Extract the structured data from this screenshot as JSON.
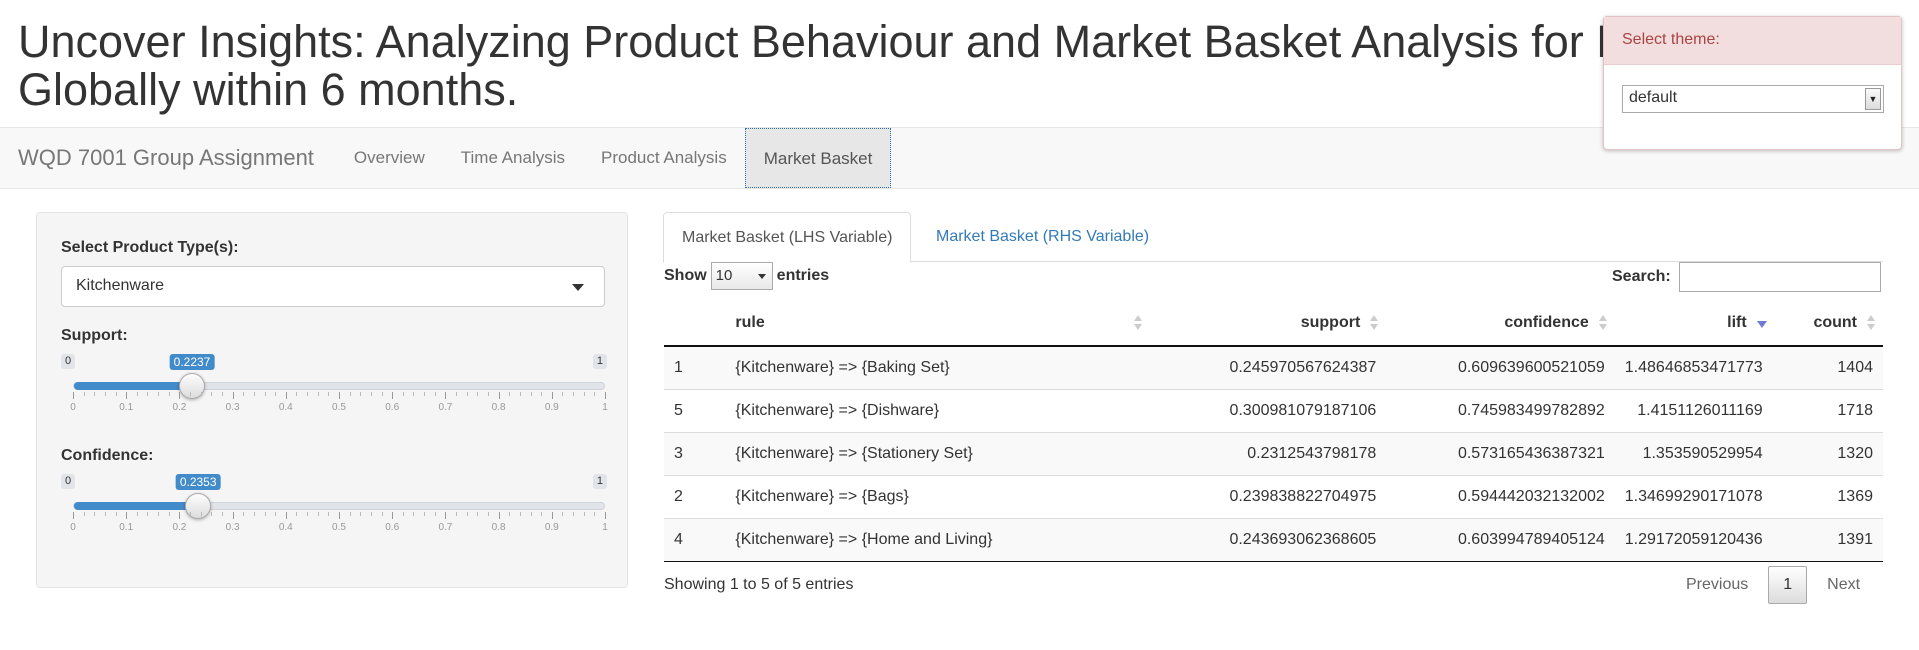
{
  "page": {
    "title_line1": "Uncover Insights: Analyzing Product Behaviour and Market Basket Analysis for Ret",
    "title_line2": "Globally within 6 months."
  },
  "navbar": {
    "brand": "WQD 7001 Group Assignment",
    "tabs": [
      {
        "label": "Overview",
        "active": false
      },
      {
        "label": "Time Analysis",
        "active": false
      },
      {
        "label": "Product Analysis",
        "active": false
      },
      {
        "label": "Market Basket",
        "active": true
      }
    ]
  },
  "theme_selector": {
    "heading": "Select theme:",
    "value": "default"
  },
  "sidebar": {
    "product_type": {
      "label": "Select Product Type(s):",
      "value": "Kitchenware"
    },
    "support": {
      "label": "Support:",
      "min": "0",
      "max": "1",
      "value": "0.2237",
      "fraction": 0.2237
    },
    "confidence": {
      "label": "Confidence:",
      "min": "0",
      "max": "1",
      "value": "0.2353",
      "fraction": 0.2353
    },
    "tick_labels": [
      "0",
      "0.1",
      "0.2",
      "0.3",
      "0.4",
      "0.5",
      "0.6",
      "0.7",
      "0.8",
      "0.9",
      "1"
    ]
  },
  "tabs": [
    {
      "label": "Market Basket (LHS Variable)",
      "active": true
    },
    {
      "label": "Market Basket (RHS Variable)",
      "active": false
    }
  ],
  "table": {
    "show_label": "Show",
    "entries_value": "10",
    "entries_label": "entries",
    "search_label": "Search:",
    "columns": [
      "",
      "rule",
      "support",
      "confidence",
      "lift",
      "count"
    ],
    "sorted_column": "lift",
    "sort_direction": "descending",
    "rows": [
      [
        "1",
        "{Kitchenware} => {Baking Set}",
        "0.245970567624387",
        "0.609639600521059",
        "1.48646853471773",
        "1404"
      ],
      [
        "5",
        "{Kitchenware} => {Dishware}",
        "0.300981079187106",
        "0.745983499782892",
        "1.4151126011169",
        "1718"
      ],
      [
        "3",
        "{Kitchenware} => {Stationery Set}",
        "0.2312543798178",
        "0.573165436387321",
        "1.353590529954",
        "1320"
      ],
      [
        "2",
        "{Kitchenware} => {Bags}",
        "0.239838822704975",
        "0.594442032132002",
        "1.34699290171078",
        "1369"
      ],
      [
        "4",
        "{Kitchenware} => {Home and Living}",
        "0.243693062368605",
        "0.603994789405124",
        "1.29172059120436",
        "1391"
      ]
    ],
    "info": "Showing 1 to 5 of 5 entries",
    "pager": {
      "previous": "Previous",
      "current": "1",
      "next": "Next"
    }
  }
}
